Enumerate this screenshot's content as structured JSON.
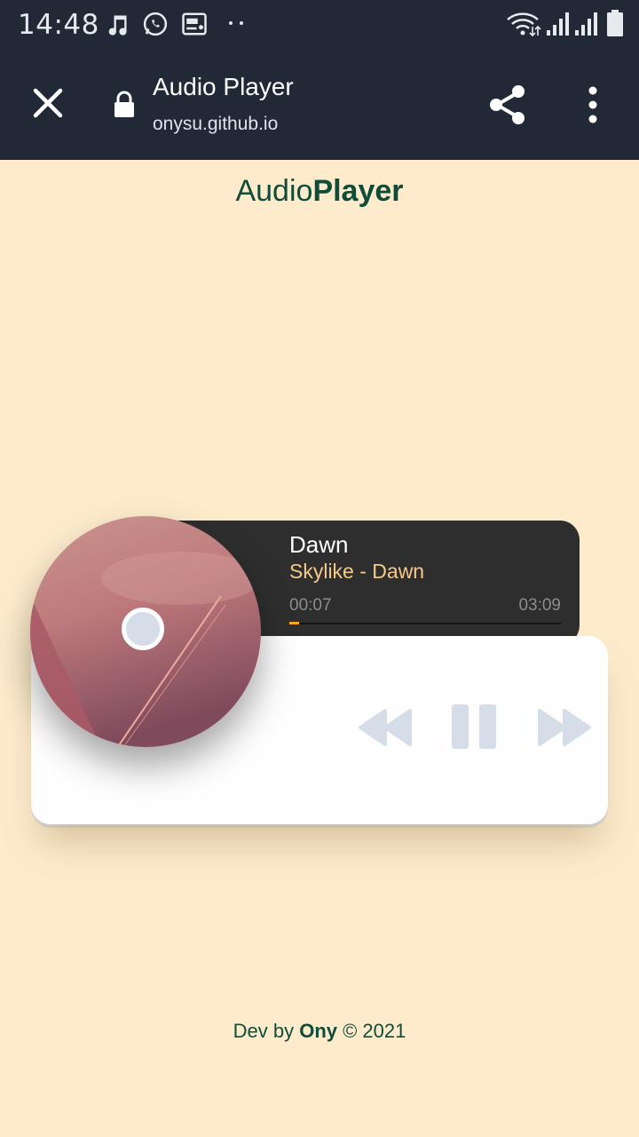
{
  "status_bar": {
    "time": "14:48",
    "icons": [
      "music-note-icon",
      "whatsapp-icon",
      "radio-icon",
      "more-dots-icon",
      "wifi-icon",
      "signal-icon",
      "signal-icon",
      "battery-icon"
    ]
  },
  "browser": {
    "page_title": "Audio Player",
    "url": "onysu.github.io",
    "icons": [
      "close-icon",
      "lock-icon",
      "share-icon",
      "more-vert-icon"
    ]
  },
  "app": {
    "brand_light": "Audio",
    "brand_bold": "Player"
  },
  "player": {
    "title": "Dawn",
    "artist_line": "Skylike - Dawn",
    "current_time": "00:07",
    "duration": "03:09",
    "progress": 0.037,
    "controls": [
      "rewind-icon",
      "pause-icon",
      "fast-forward-icon"
    ]
  },
  "footer": {
    "prefix": "Dev by ",
    "author": "Ony",
    "suffix": " © 2021"
  },
  "colors": {
    "background": "#fdebcc",
    "toolbar": "#212936",
    "brand_text": "#0f4c3a",
    "panel": "#2e2e2e",
    "artist_text": "#f5c987",
    "progress_fill": "#f5a623",
    "control_icons": "#d5dde8"
  }
}
